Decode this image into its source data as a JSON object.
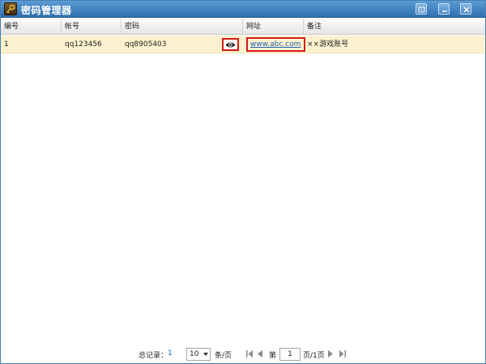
{
  "window": {
    "title": "密码管理器"
  },
  "grid": {
    "columns": [
      "编号",
      "帐号",
      "密码",
      "网址",
      "备注"
    ],
    "rows": [
      {
        "id": "1",
        "account": "qq123456",
        "password": "qq8905403",
        "url": "www.abc.com",
        "note": "××游戏账号"
      }
    ]
  },
  "footer": {
    "total_label": "总记录：",
    "total_count": "1",
    "page_size": "10",
    "per_page_label": "条/页",
    "page_prefix": "第",
    "current_page": "1",
    "page_suffix": "页/1页"
  },
  "colors": {
    "titlebar": "#3f83c4",
    "row_selected": "#fdf2cf",
    "highlight_border": "#d21a1a",
    "link": "#1f5fb0"
  },
  "icons": [
    "key-icon",
    "restore-icon",
    "minimize-icon",
    "close-icon",
    "eye-icon",
    "dropdown-arrow-icon",
    "first-page-icon",
    "prev-page-icon",
    "next-page-icon",
    "last-page-icon"
  ]
}
